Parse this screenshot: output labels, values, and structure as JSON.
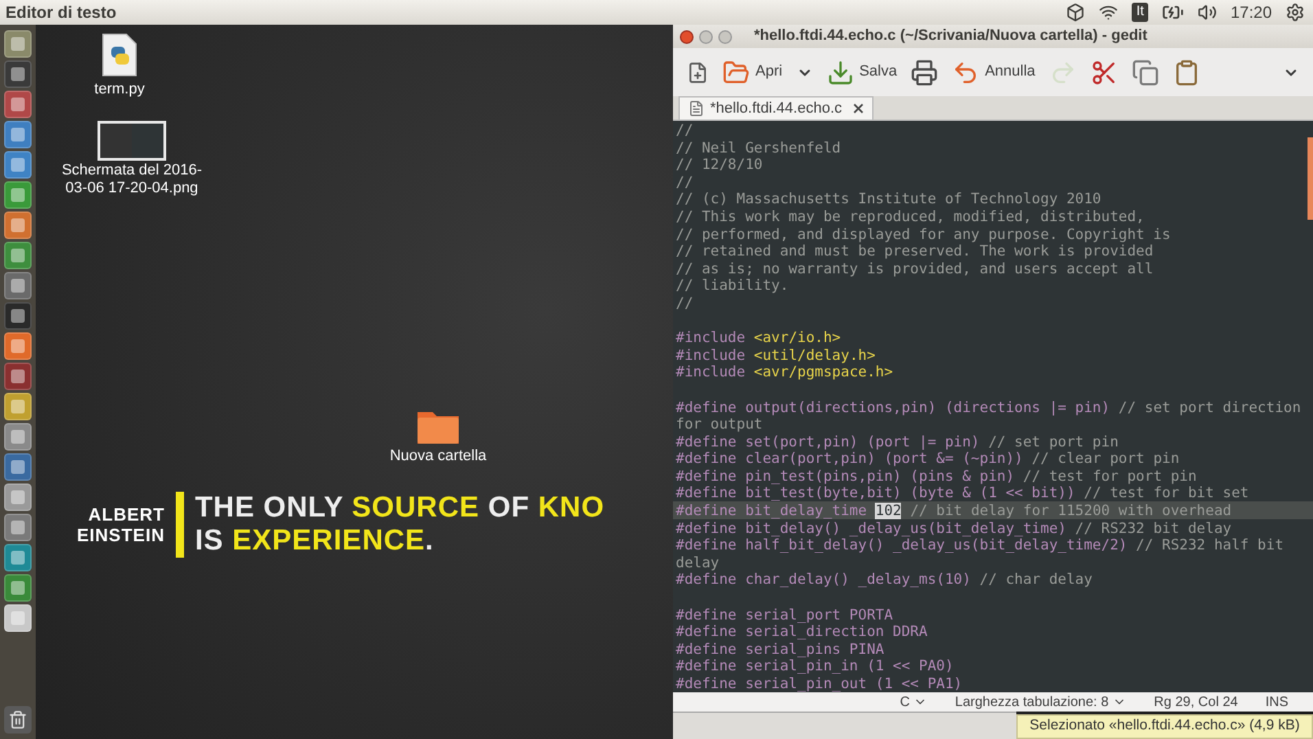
{
  "top_panel": {
    "title": "Editor di testo",
    "keyboard_layout": "It",
    "clock": "17:20"
  },
  "desktop": {
    "icons": [
      {
        "kind": "python_file",
        "label": "term.py"
      },
      {
        "kind": "screenshot",
        "label": "Schermata del 2016-03-06 17-20-04.png"
      },
      {
        "kind": "folder",
        "label": "Nuova cartella"
      }
    ],
    "wallpaper_quote": {
      "author_lines": [
        "ALBERT",
        "EINSTEIN"
      ],
      "lines": [
        {
          "parts": [
            {
              "text": "THE ONLY ",
              "highlight": false
            },
            {
              "text": "SOURCE",
              "highlight": true
            },
            {
              "text": " OF ",
              "highlight": false
            },
            {
              "text": "KNO",
              "highlight": true
            }
          ]
        },
        {
          "parts": [
            {
              "text": "IS ",
              "highlight": false
            },
            {
              "text": "EXPERIENCE",
              "highlight": true
            },
            {
              "text": ".",
              "highlight": false
            }
          ]
        }
      ]
    }
  },
  "window": {
    "title": "*hello.ftdi.44.echo.c (~/Scrivania/Nuova cartella) - gedit",
    "toolbar": [
      {
        "kind": "new",
        "disabled": false
      },
      {
        "kind": "open",
        "label": "Apri",
        "disabled": false
      },
      {
        "kind": "menu",
        "disabled": false
      },
      {
        "kind": "save",
        "label": "Salva",
        "disabled": false
      },
      {
        "kind": "print",
        "disabled": false
      },
      {
        "kind": "undo",
        "label": "Annulla",
        "disabled": false
      },
      {
        "kind": "redo",
        "disabled": true
      },
      {
        "kind": "cut",
        "disabled": false
      },
      {
        "kind": "copy",
        "disabled": false
      },
      {
        "kind": "paste",
        "disabled": false
      },
      {
        "kind": "overflow",
        "disabled": false
      }
    ],
    "tabs": [
      {
        "label": "*hello.ftdi.44.echo.c",
        "selected": true
      }
    ],
    "code_lines": [
      {
        "kind": "code",
        "current": false,
        "tokens": [
          {
            "kind": "comment",
            "text": "//"
          }
        ]
      },
      {
        "kind": "code",
        "current": false,
        "tokens": [
          {
            "kind": "comment",
            "text": "// Neil Gershenfeld"
          }
        ]
      },
      {
        "kind": "code",
        "current": false,
        "tokens": [
          {
            "kind": "comment",
            "text": "// 12/8/10"
          }
        ]
      },
      {
        "kind": "code",
        "current": false,
        "tokens": [
          {
            "kind": "comment",
            "text": "//"
          }
        ]
      },
      {
        "kind": "code",
        "current": false,
        "tokens": [
          {
            "kind": "comment",
            "text": "// (c) Massachusetts Institute of Technology 2010"
          }
        ]
      },
      {
        "kind": "code",
        "current": false,
        "tokens": [
          {
            "kind": "comment",
            "text": "// This work may be reproduced, modified, distributed,"
          }
        ]
      },
      {
        "kind": "code",
        "current": false,
        "tokens": [
          {
            "kind": "comment",
            "text": "// performed, and displayed for any purpose. Copyright is"
          }
        ]
      },
      {
        "kind": "code",
        "current": false,
        "tokens": [
          {
            "kind": "comment",
            "text": "// retained and must be preserved. The work is provided"
          }
        ]
      },
      {
        "kind": "code",
        "current": false,
        "tokens": [
          {
            "kind": "comment",
            "text": "// as is; no warranty is provided, and users accept all"
          }
        ]
      },
      {
        "kind": "code",
        "current": false,
        "tokens": [
          {
            "kind": "comment",
            "text": "// liability."
          }
        ]
      },
      {
        "kind": "code",
        "current": false,
        "tokens": [
          {
            "kind": "comment",
            "text": "//"
          }
        ]
      },
      {
        "kind": "blank"
      },
      {
        "kind": "code",
        "current": false,
        "tokens": [
          {
            "kind": "preproc",
            "text": "#include "
          },
          {
            "kind": "string",
            "text": "<avr/io.h>"
          }
        ]
      },
      {
        "kind": "code",
        "current": false,
        "tokens": [
          {
            "kind": "preproc",
            "text": "#include "
          },
          {
            "kind": "string",
            "text": "<util/delay.h>"
          }
        ]
      },
      {
        "kind": "code",
        "current": false,
        "tokens": [
          {
            "kind": "preproc",
            "text": "#include "
          },
          {
            "kind": "string",
            "text": "<avr/pgmspace.h>"
          }
        ]
      },
      {
        "kind": "blank"
      },
      {
        "kind": "code",
        "current": false,
        "tokens": [
          {
            "kind": "preproc",
            "text": "#define output(directions,pin) (directions |= pin) "
          },
          {
            "kind": "comment",
            "text": "// set port direction"
          }
        ]
      },
      {
        "kind": "code",
        "current": false,
        "tokens": [
          {
            "kind": "comment",
            "text": "for output"
          }
        ]
      },
      {
        "kind": "code",
        "current": false,
        "tokens": [
          {
            "kind": "preproc",
            "text": "#define set(port,pin) (port |= pin) "
          },
          {
            "kind": "comment",
            "text": "// set port pin"
          }
        ]
      },
      {
        "kind": "code",
        "current": false,
        "tokens": [
          {
            "kind": "preproc",
            "text": "#define clear(port,pin) (port &= (~pin)) "
          },
          {
            "kind": "comment",
            "text": "// clear port pin"
          }
        ]
      },
      {
        "kind": "code",
        "current": false,
        "tokens": [
          {
            "kind": "preproc",
            "text": "#define pin_test(pins,pin) (pins & pin) "
          },
          {
            "kind": "comment",
            "text": "// test for port pin"
          }
        ]
      },
      {
        "kind": "code",
        "current": false,
        "tokens": [
          {
            "kind": "preproc",
            "text": "#define bit_test(byte,bit) (byte & (1 << bit)) "
          },
          {
            "kind": "comment",
            "text": "// test for bit set"
          }
        ]
      },
      {
        "kind": "code",
        "current": true,
        "tokens": [
          {
            "kind": "preproc",
            "text": "#define bit_delay_time "
          },
          {
            "kind": "selected",
            "text": "102"
          },
          {
            "kind": "comment",
            "text": " // bit delay for 115200 with overhead"
          }
        ]
      },
      {
        "kind": "code",
        "current": false,
        "tokens": [
          {
            "kind": "preproc",
            "text": "#define bit_delay() _delay_us(bit_delay_time) "
          },
          {
            "kind": "comment",
            "text": "// RS232 bit delay"
          }
        ]
      },
      {
        "kind": "code",
        "current": false,
        "tokens": [
          {
            "kind": "preproc",
            "text": "#define half_bit_delay() _delay_us(bit_delay_time/2) "
          },
          {
            "kind": "comment",
            "text": "// RS232 half bit"
          }
        ]
      },
      {
        "kind": "code",
        "current": false,
        "tokens": [
          {
            "kind": "comment",
            "text": "delay"
          }
        ]
      },
      {
        "kind": "code",
        "current": false,
        "tokens": [
          {
            "kind": "preproc",
            "text": "#define char_delay() _delay_ms(10) "
          },
          {
            "kind": "comment",
            "text": "// char delay"
          }
        ]
      },
      {
        "kind": "blank"
      },
      {
        "kind": "code",
        "current": false,
        "tokens": [
          {
            "kind": "preproc",
            "text": "#define serial_port PORTA"
          }
        ]
      },
      {
        "kind": "code",
        "current": false,
        "tokens": [
          {
            "kind": "preproc",
            "text": "#define serial_direction DDRA"
          }
        ]
      },
      {
        "kind": "code",
        "current": false,
        "tokens": [
          {
            "kind": "preproc",
            "text": "#define serial_pins PINA"
          }
        ]
      },
      {
        "kind": "code",
        "current": false,
        "tokens": [
          {
            "kind": "preproc",
            "text": "#define serial_pin_in (1 << PA0)"
          }
        ]
      },
      {
        "kind": "code",
        "current": false,
        "tokens": [
          {
            "kind": "preproc",
            "text": "#define serial_pin_out (1 << PA1)"
          }
        ]
      }
    ],
    "status_bar": {
      "language": "C",
      "tab_width": "Larghezza tabulazione: 8",
      "position": "Rg 29, Col 24",
      "mode": "INS"
    }
  },
  "tooltip": "Selezionato «hello.ftdi.44.echo.c» (4,9 kB)"
}
